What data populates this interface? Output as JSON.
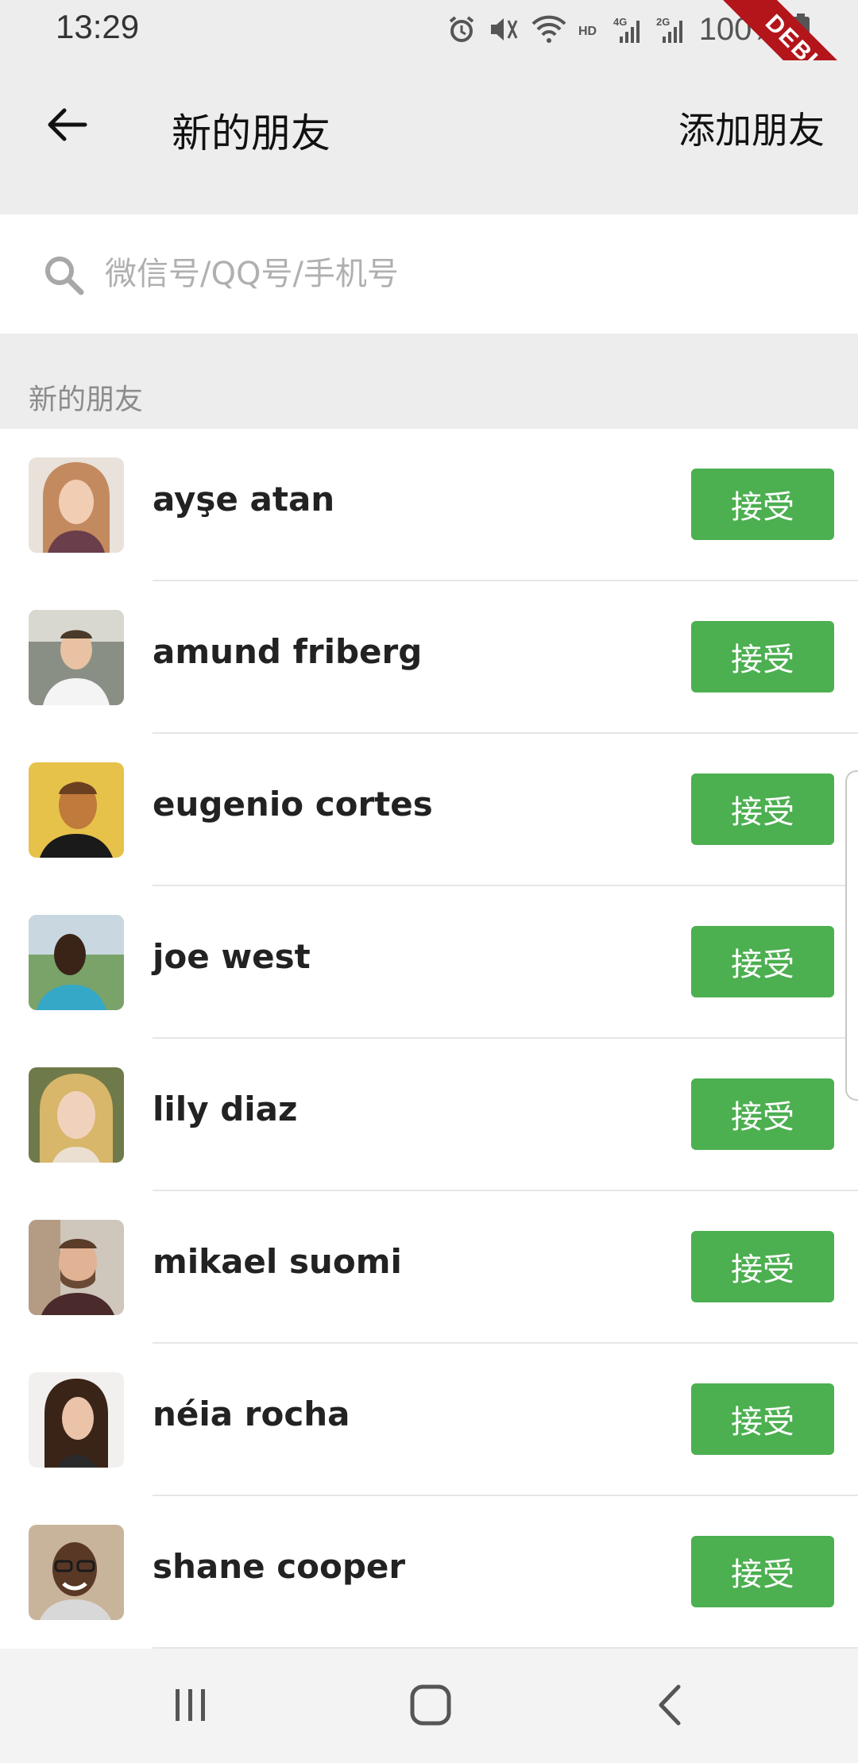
{
  "status_bar": {
    "time": "13:29",
    "battery": "100%",
    "icons": [
      "alarm-icon",
      "mute-icon",
      "wifi-icon",
      "hd-icon",
      "4g-signal-icon",
      "2g-signal-icon",
      "battery-icon"
    ],
    "debug_label": "DEBUG"
  },
  "app_bar": {
    "title": "新的朋友",
    "action_label": "添加朋友",
    "back_icon": "arrow-left-icon"
  },
  "search": {
    "placeholder": "微信号/QQ号/手机号",
    "value": "",
    "icon": "search-icon"
  },
  "section": {
    "title": "新的朋友"
  },
  "friends": [
    {
      "name": "ayşe atan",
      "action": "接受"
    },
    {
      "name": "amund friberg",
      "action": "接受"
    },
    {
      "name": "eugenio cortes",
      "action": "接受"
    },
    {
      "name": "joe west",
      "action": "接受"
    },
    {
      "name": "lily diaz",
      "action": "接受"
    },
    {
      "name": "mikael suomi",
      "action": "接受"
    },
    {
      "name": "néia rocha",
      "action": "接受"
    },
    {
      "name": "shane cooper",
      "action": "接受"
    }
  ],
  "nav": {
    "icons": [
      "recent-apps-icon",
      "home-icon",
      "back-icon"
    ]
  },
  "colors": {
    "accent": "#4caf50",
    "background": "#ededed",
    "debug": "#b3151a"
  }
}
